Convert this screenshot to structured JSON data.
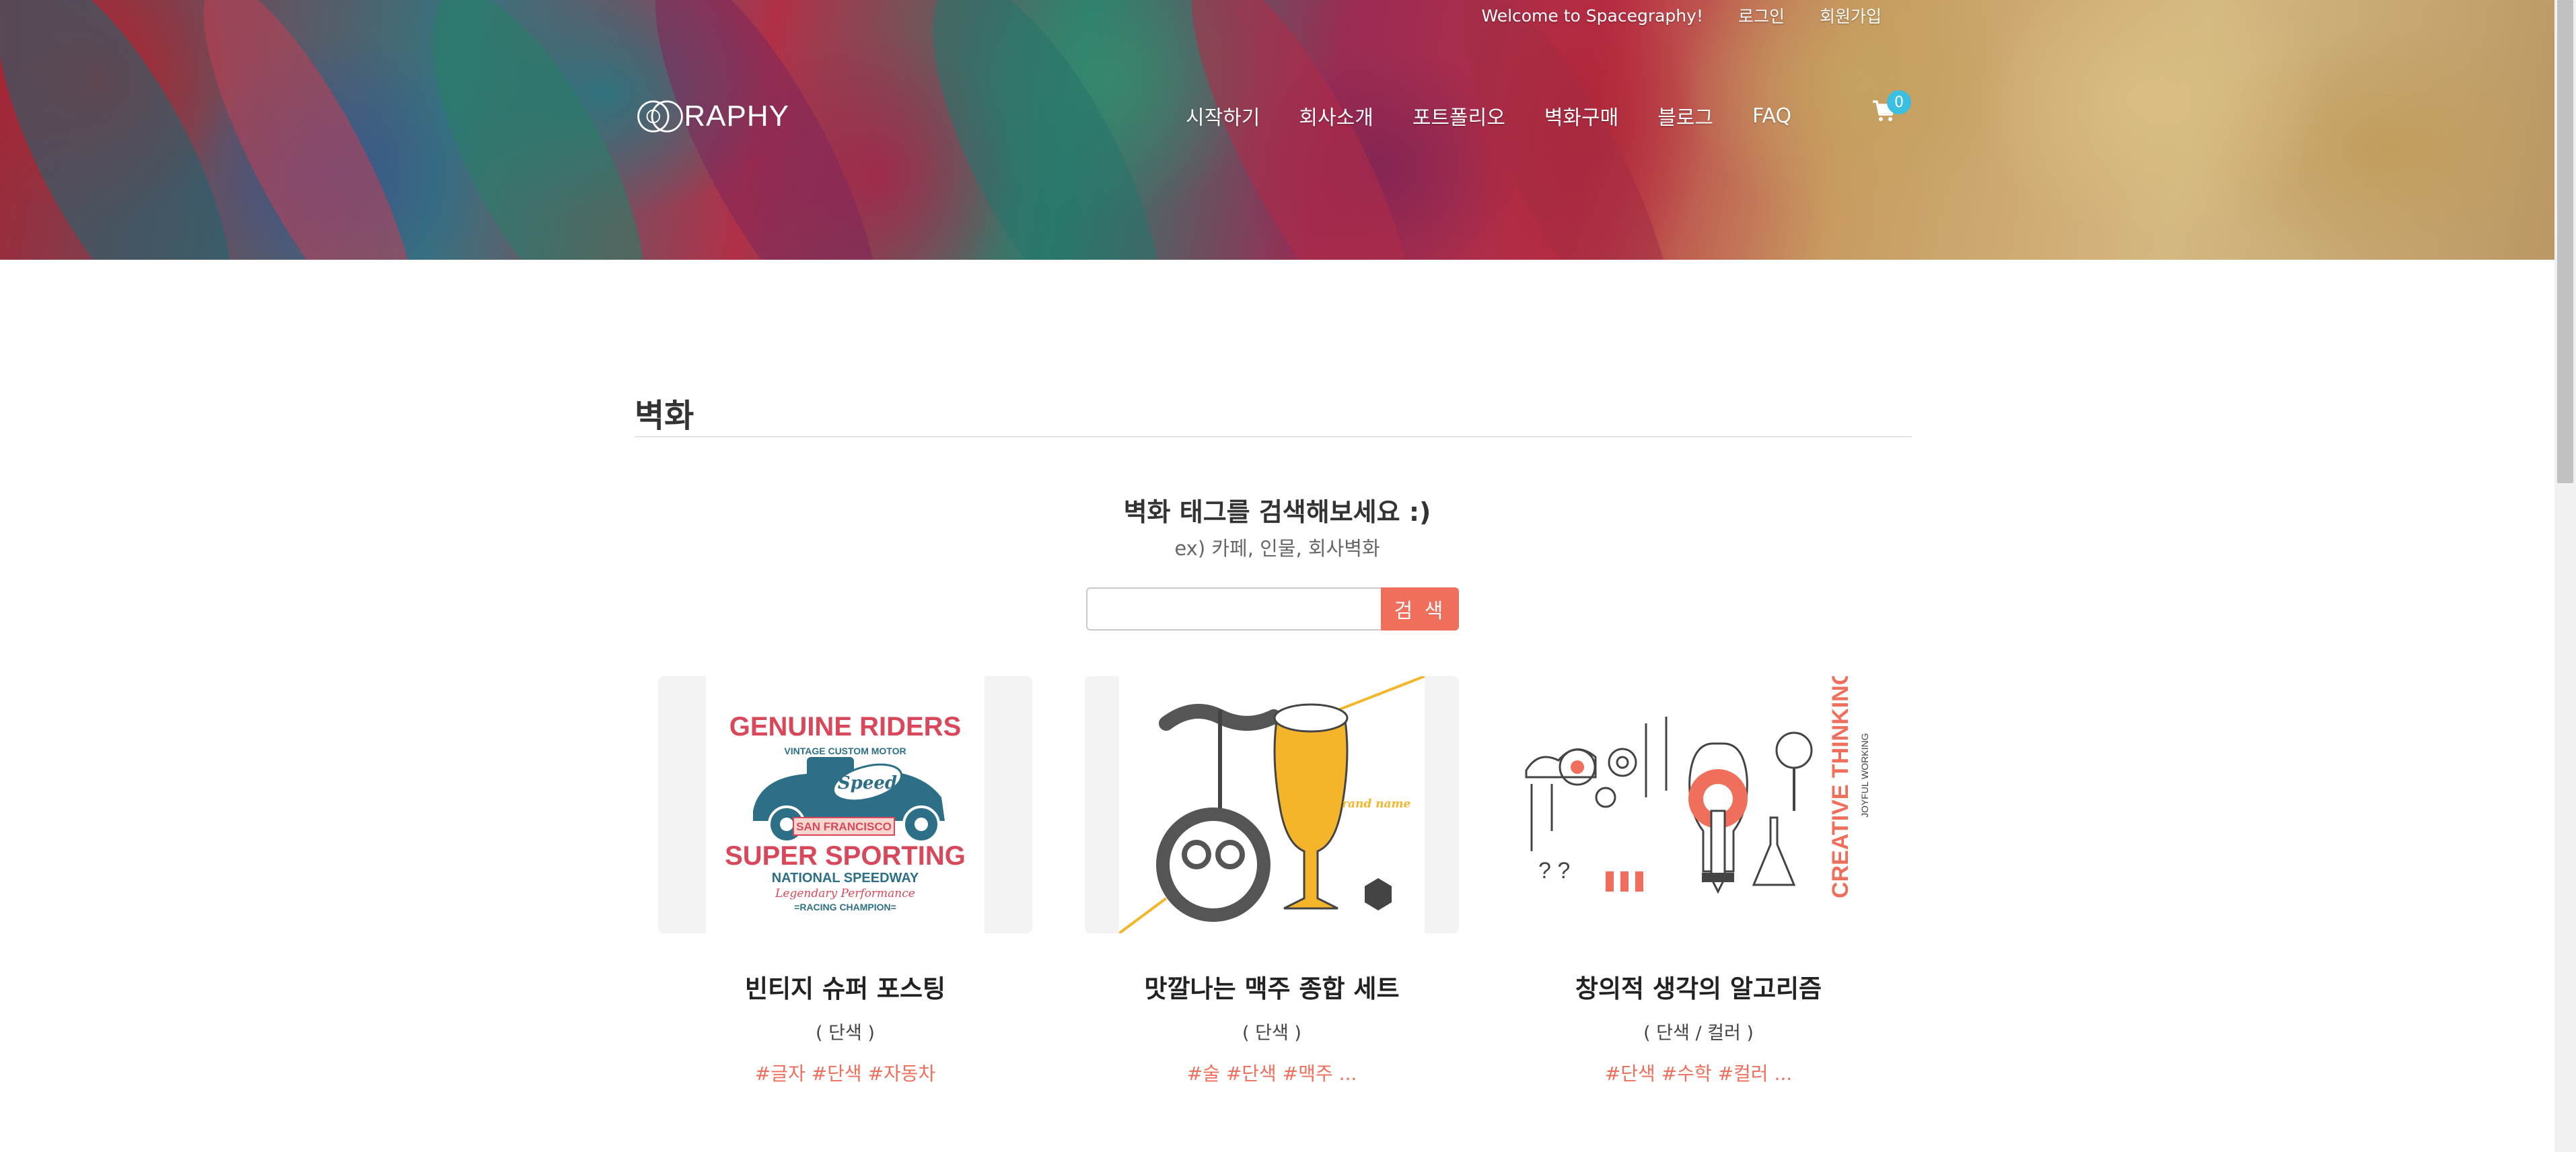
{
  "topbar": {
    "welcome": "Welcome to Spacegraphy!",
    "login": "로그인",
    "signup": "회원가입"
  },
  "logo": {
    "text": "RAPHY"
  },
  "nav": {
    "items": [
      "시작하기",
      "회사소개",
      "포트폴리오",
      "벽화구매",
      "블로그",
      "FAQ"
    ]
  },
  "cart": {
    "count": "0",
    "icon": "cart-icon"
  },
  "main": {
    "section_title": "벽화",
    "search_heading": "벽화 태그를 검색해보세요 :)",
    "search_sub": "ex) 카페, 인물, 회사벽화",
    "search_input_value": "",
    "search_button": "검 색"
  },
  "products": [
    {
      "title": "빈티지 슈퍼 포스팅",
      "sub": "( 단색 )",
      "tags": "#글자 #단색 #자동차"
    },
    {
      "title": "맛깔나는 맥주 종합 세트",
      "sub": "( 단색 )",
      "tags": "#술 #단색 #맥주 ..."
    },
    {
      "title": "창의적 생각의 알고리즘",
      "sub": "( 단색 / 컬러 )",
      "tags": "#단색 #수학 #컬러 ..."
    }
  ],
  "artwork_text": {
    "p1_line1": "GENUINE RIDERS",
    "p1_line2": "VINTAGE CUSTOM MOTOR",
    "p1_badge": "Speed",
    "p1_city": "SAN FRANCISCO",
    "p1_line3": "SUPER SPORTING",
    "p1_line4": "NATIONAL SPEEDWAY",
    "p1_line5": "Legendary Performance",
    "p1_line6": "=RACING CHAMPION=",
    "p2_brand": "Brand name",
    "p3_vertical1": "CREATIVE THINKING",
    "p3_vertical2": "JOYFUL WORKING"
  },
  "colors": {
    "accent": "#ef6f5c",
    "badge": "#3bbfe0",
    "car_blue": "#2d6f86",
    "car_red": "#d9485a",
    "beer": "#f4b52a"
  }
}
